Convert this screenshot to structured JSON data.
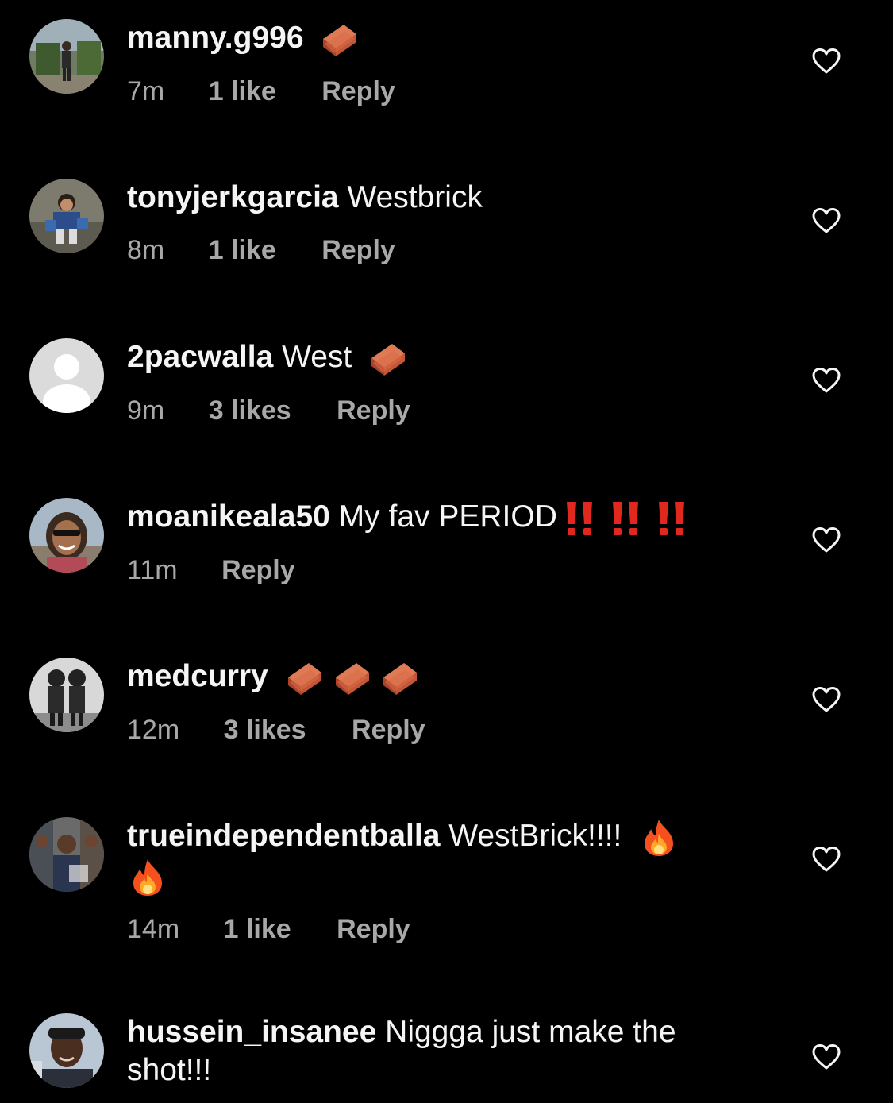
{
  "colors": {
    "background": "#000000",
    "text": "#f5f5f5",
    "meta": "#a8a8a8"
  },
  "comments": [
    {
      "username": "manny.g996",
      "text": "",
      "emojis": [
        "brick-icon"
      ],
      "time": "7m",
      "likes": "1 like",
      "reply": "Reply"
    },
    {
      "username": "tonyjerkgarcia",
      "text": "Westbrick",
      "emojis": [],
      "time": "8m",
      "likes": "1 like",
      "reply": "Reply"
    },
    {
      "username": "2pacwalla",
      "text": "West",
      "emojis": [
        "brick-icon"
      ],
      "time": "9m",
      "likes": "3 likes",
      "reply": "Reply"
    },
    {
      "username": "moanikeala50",
      "text": "My fav PERIOD",
      "emojis": [
        "double-exclamation-icon",
        "double-exclamation-icon",
        "double-exclamation-icon"
      ],
      "time": "11m",
      "likes": "",
      "reply": "Reply"
    },
    {
      "username": "medcurry",
      "text": "",
      "emojis": [
        "brick-icon",
        "brick-icon",
        "brick-icon"
      ],
      "time": "12m",
      "likes": "3 likes",
      "reply": "Reply"
    },
    {
      "username": "trueindependentballa",
      "text": "WestBrick!!!!",
      "emojis": [
        "fire-icon",
        "fire-icon"
      ],
      "time": "14m",
      "likes": "1 like",
      "reply": "Reply"
    },
    {
      "username": "hussein_insanee",
      "text": "Niggga just make the shot!!!",
      "emojis": [],
      "time": "",
      "likes": "",
      "reply": ""
    }
  ]
}
